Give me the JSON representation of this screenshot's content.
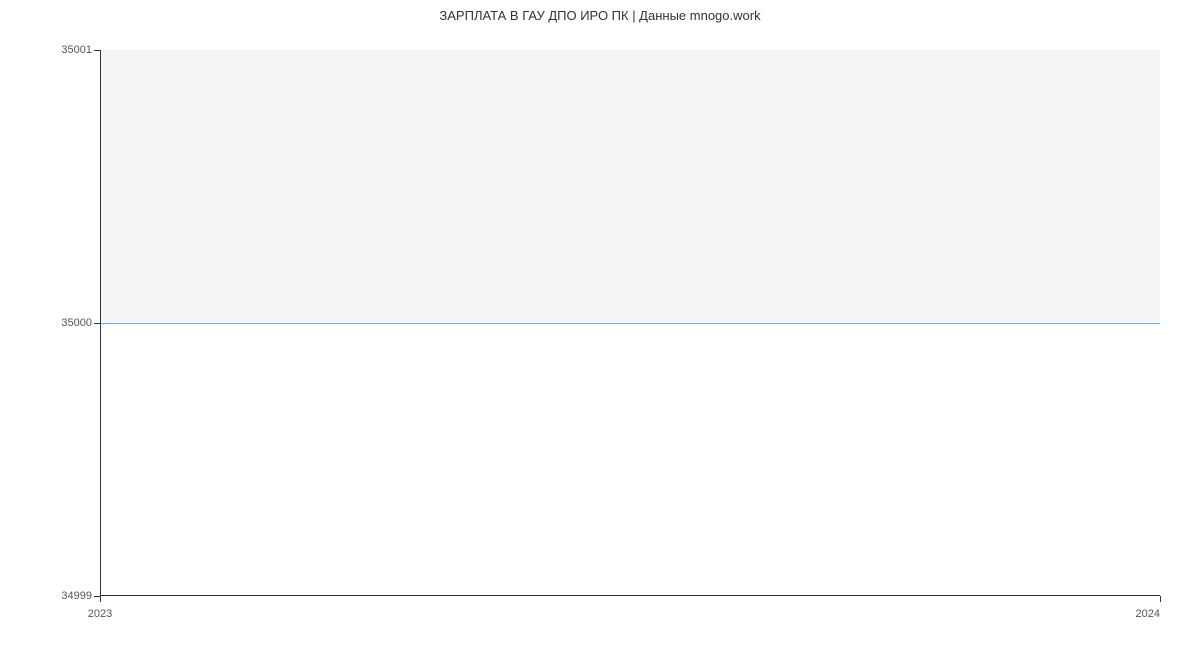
{
  "chart_data": {
    "type": "line",
    "title": "ЗАРПЛАТА В ГАУ ДПО ИРО ПК | Данные mnogo.work",
    "xlabel": "",
    "ylabel": "",
    "x": [
      "2023",
      "2024"
    ],
    "values": [
      35000,
      35000
    ],
    "ylim": [
      34999,
      35001
    ],
    "y_ticks": [
      "34999",
      "35000",
      "35001"
    ],
    "x_ticks": [
      "2023",
      "2024"
    ]
  }
}
